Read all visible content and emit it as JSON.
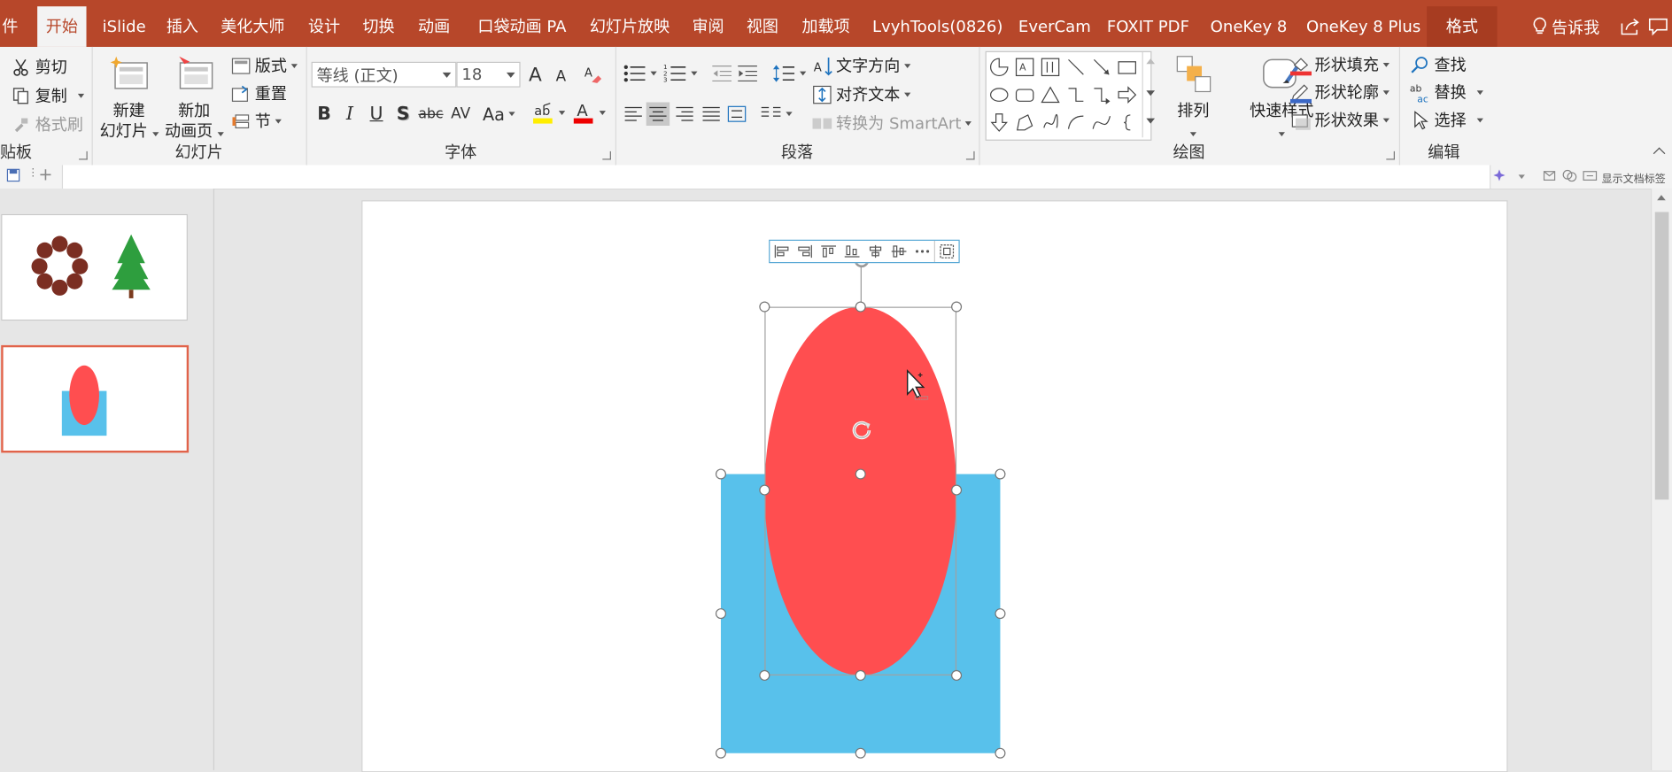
{
  "tabs": [
    {
      "label": "件"
    },
    {
      "label": "开始"
    },
    {
      "label": "iSlide"
    },
    {
      "label": "插入"
    },
    {
      "label": "美化大师"
    },
    {
      "label": "设计"
    },
    {
      "label": "切换"
    },
    {
      "label": "动画"
    },
    {
      "label": "口袋动画 PA"
    },
    {
      "label": "幻灯片放映"
    },
    {
      "label": "审阅"
    },
    {
      "label": "视图"
    },
    {
      "label": "加载项"
    },
    {
      "label": "LvyhTools(0826)"
    },
    {
      "label": "EverCam"
    },
    {
      "label": "FOXIT PDF"
    },
    {
      "label": "OneKey 8"
    },
    {
      "label": "OneKey 8 Plus"
    },
    {
      "label": "格式"
    }
  ],
  "tell_me": "告诉我",
  "clipboard": {
    "cut": "剪切",
    "copy": "复制",
    "format_painter": "格式刷",
    "label": "贴板"
  },
  "slides_group": {
    "new_slide_1": "新建",
    "new_slide_2": "幻灯片",
    "new_anim_1": "新加",
    "new_anim_2": "动画页",
    "layout": "版式",
    "reset": "重置",
    "section": "节",
    "label": "幻灯片"
  },
  "font": {
    "name": "等线 (正文)",
    "size": "18",
    "label": "字体",
    "bold": "B",
    "italic": "I",
    "underline": "U",
    "shadow": "S",
    "strike": "abc",
    "spacing": "AV",
    "case": "Aa",
    "grow": "A",
    "shrink": "A"
  },
  "paragraph": {
    "text_direction": "文字方向",
    "align_text": "对齐文本",
    "smartart": "转换为 SmartArt",
    "label": "段落"
  },
  "drawing": {
    "arrange": "排列",
    "quick_styles": "快速样式",
    "fill": "形状填充",
    "outline": "形状轮廓",
    "effects": "形状效果",
    "label": "绘图"
  },
  "editing": {
    "find": "查找",
    "replace": "替换",
    "select": "选择",
    "label": "编辑"
  },
  "qat": {
    "show_tags": "显示文档标签"
  },
  "shapes": {
    "ellipse_color": "#ff4e50",
    "rect_color": "#58c1eb",
    "accent": "#b7472a",
    "selection_border": "#e1634a"
  }
}
